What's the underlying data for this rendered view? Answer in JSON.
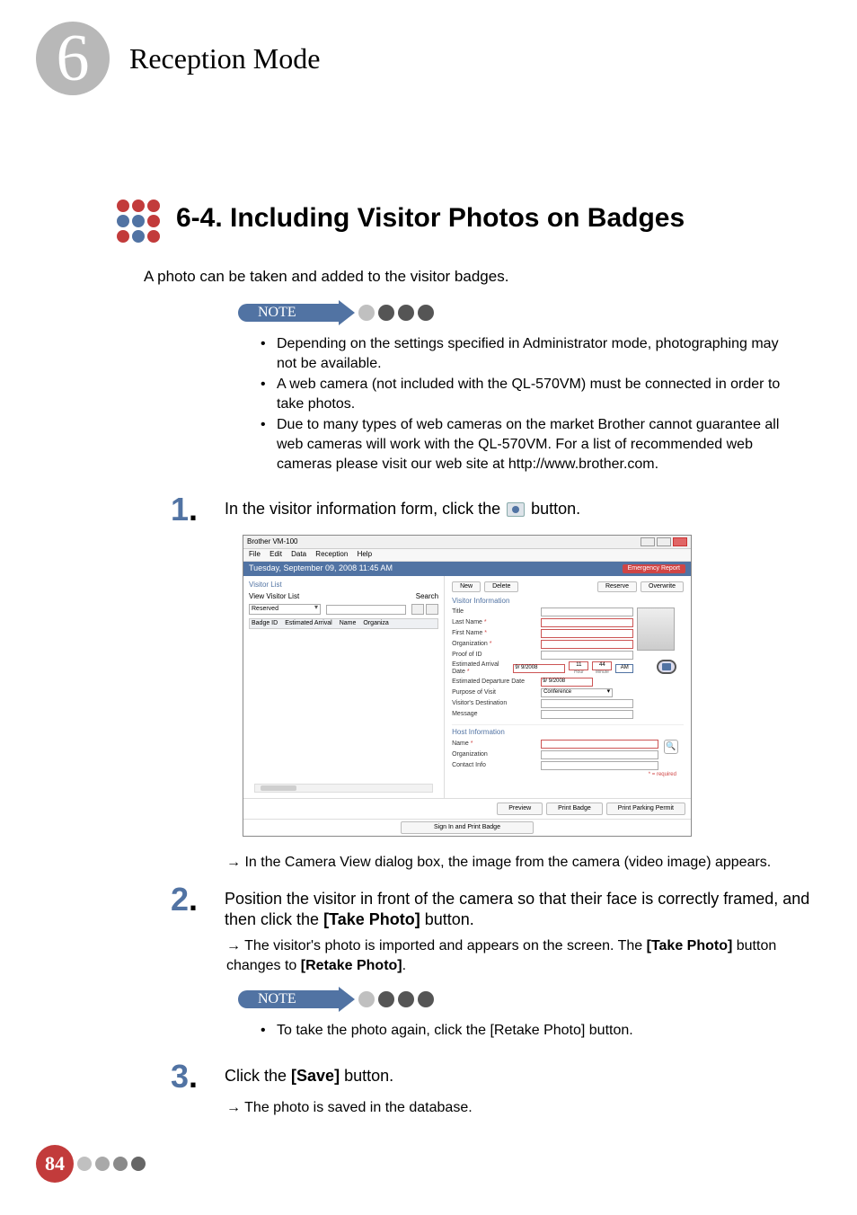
{
  "chapter": {
    "number": "6",
    "title": "Reception Mode"
  },
  "section": {
    "heading": "6-4.  Including Visitor Photos on Badges"
  },
  "intro": "A photo can be taken and added to the visitor badges.",
  "noteLabel": "NOTE",
  "noteBullets": [
    "Depending on the settings specified in Administrator mode, photographing may not be available.",
    "A web camera (not included with the QL-570VM) must be connected in order to take photos.",
    "Due to many types of web cameras on the market Brother cannot guarantee all web cameras will work with the QL-570VM. For a list of recommended web cameras please visit our web site at http://www.brother.com."
  ],
  "steps": {
    "s1": {
      "num": "1",
      "textBefore": "In the visitor information form, click the ",
      "textAfter": " button."
    },
    "s1arrow": "In the Camera View dialog box, the image from the camera (video image) appears.",
    "s2": {
      "num": "2",
      "textBefore": "Position the visitor in front of the camera so that their face is correctly framed, and then click the ",
      "bold": "[Take Photo]",
      "textAfter": " button."
    },
    "s2arrowBefore": "The visitor's photo is imported and appears on the screen. The ",
    "s2arrowBold1": "[Take Photo]",
    "s2arrowMiddle": " button changes to ",
    "s2arrowBold2": "[Retake Photo]",
    "s2arrowAfter": ".",
    "s2noteBefore": "To take the photo again, click the ",
    "s2noteBold": "[Retake Photo]",
    "s2noteAfter": " button.",
    "s3": {
      "num": "3",
      "textBefore": "Click the ",
      "bold": "[Save]",
      "textAfter": " button."
    },
    "s3arrow": "The photo is saved in the database."
  },
  "app": {
    "title": "Brother VM-100",
    "menus": [
      "File",
      "Edit",
      "Data",
      "Reception",
      "Help"
    ],
    "dateTime": "Tuesday, September 09, 2008 11:45 AM",
    "emergency": "Emergency Report",
    "left": {
      "header": "Visitor List",
      "viewVisitorList": "View Visitor List",
      "searchLabel": "Search",
      "reserved": "Reserved",
      "cols": [
        "Badge ID",
        "Estimated Arrival",
        "Name",
        "Organiza"
      ]
    },
    "toolbar": {
      "new": "New",
      "delete": "Delete",
      "reserve": "Reserve",
      "overwrite": "Overwrite"
    },
    "visitorInfoHeader": "Visitor Information",
    "fields": {
      "title": "Title",
      "lastName": "Last Name",
      "firstName": "First Name",
      "organization": "Organization",
      "proofOfId": "Proof of ID",
      "estArrival": "Estimated Arrival Date",
      "estDeparture": "Estimated Departure Date",
      "purpose": "Purpose of Visit",
      "destination": "Visitor's Destination",
      "message": "Message",
      "purposeValue": "Conference"
    },
    "dateValue": "9/ 9/2008",
    "timeHour": "11",
    "timeMin": "44",
    "hourLabel": "Hour",
    "minLabel": "Minute",
    "ampm": "AM",
    "hostHeader": "Host Information",
    "hostFields": {
      "name": "Name",
      "org": "Organization",
      "contact": "Contact Info"
    },
    "requiredNote": "* = required",
    "footerBtns": {
      "preview": "Preview",
      "printBadge": "Print Badge",
      "printParking": "Print Parking Permit"
    },
    "signIn": "Sign In and Print Badge"
  },
  "pageNumber": "84"
}
